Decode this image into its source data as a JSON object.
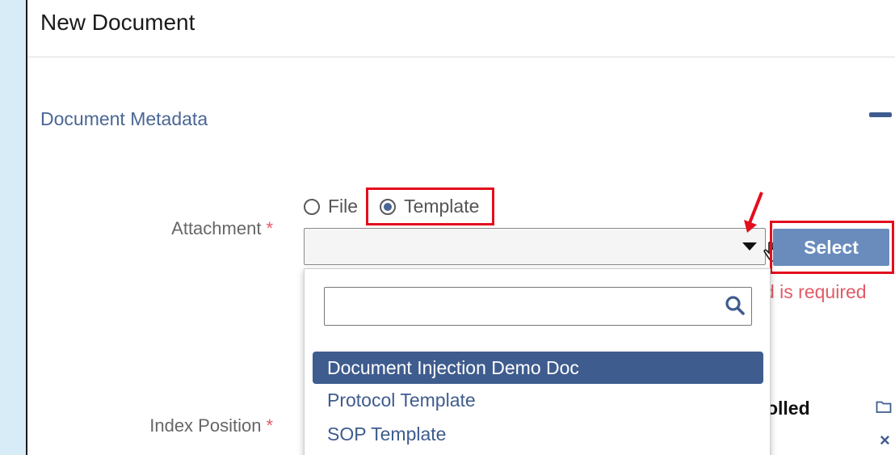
{
  "page": {
    "title": "New Document"
  },
  "section": {
    "title": "Document Metadata"
  },
  "attachment": {
    "label": "Attachment",
    "required_mark": "*",
    "options": [
      {
        "label": "File",
        "checked": false
      },
      {
        "label": "Template",
        "checked": true
      }
    ],
    "select_button": "Select",
    "error_visible": "d is required",
    "dropdown": {
      "search_value": "",
      "items": [
        {
          "label": "Document Injection Demo Doc",
          "selected": true
        },
        {
          "label": "Protocol Template",
          "selected": false
        },
        {
          "label": "SOP Template",
          "selected": false
        }
      ]
    }
  },
  "index_position": {
    "label": "Index Position",
    "required_mark": "*",
    "value_visible": "rolled",
    "clear_symbol": "×"
  },
  "colors": {
    "accent": "#3f5c8e",
    "button": "#6a8cbd",
    "error": "#e05b66",
    "highlight_outline": "#e30e1c",
    "background": "#d8ecf8"
  },
  "icons": [
    "search-icon",
    "folder-icon",
    "close-icon",
    "chevron-down-icon",
    "hand-cursor-icon",
    "red-arrow-icon"
  ]
}
